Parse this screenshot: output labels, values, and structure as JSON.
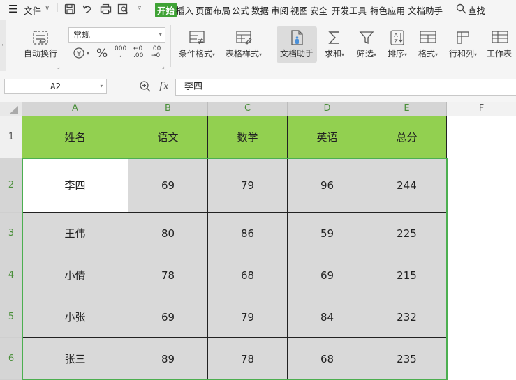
{
  "menu": {
    "file": "文件",
    "tabs": [
      "开始",
      "插入",
      "页面布局",
      "公式",
      "数据",
      "审阅",
      "视图",
      "安全",
      "开发工具",
      "特色应用",
      "文档助手"
    ],
    "active_tab": "开始",
    "search": "查找"
  },
  "ribbon": {
    "auto_wrap": "自动换行",
    "number_format": "常规",
    "percent": "%",
    "thousands": "000",
    "conditional_format": "条件格式",
    "table_style": "表格样式",
    "doc_assistant": "文档助手",
    "sum": "求和",
    "filter": "筛选",
    "sort": "排序",
    "format": "格式",
    "row_col": "行和列",
    "worksheet": "工作表"
  },
  "formula_bar": {
    "cell_ref": "A2",
    "fx": "fx",
    "content": "李四"
  },
  "sheet": {
    "columns": [
      "A",
      "B",
      "C",
      "D",
      "E",
      "F"
    ],
    "rows": [
      "1",
      "2",
      "3",
      "4",
      "5",
      "6"
    ],
    "header": [
      "姓名",
      "语文",
      "数学",
      "英语",
      "总分"
    ],
    "data": [
      [
        "李四",
        "69",
        "79",
        "96",
        "244"
      ],
      [
        "王伟",
        "80",
        "86",
        "59",
        "225"
      ],
      [
        "小倩",
        "78",
        "68",
        "69",
        "215"
      ],
      [
        "小张",
        "69",
        "79",
        "84",
        "232"
      ],
      [
        "张三",
        "89",
        "78",
        "68",
        "235"
      ]
    ]
  },
  "colors": {
    "accent": "#3fa235",
    "header_fill": "#92d050",
    "data_fill": "#d9d9d9",
    "selection_border": "#4caf50"
  }
}
